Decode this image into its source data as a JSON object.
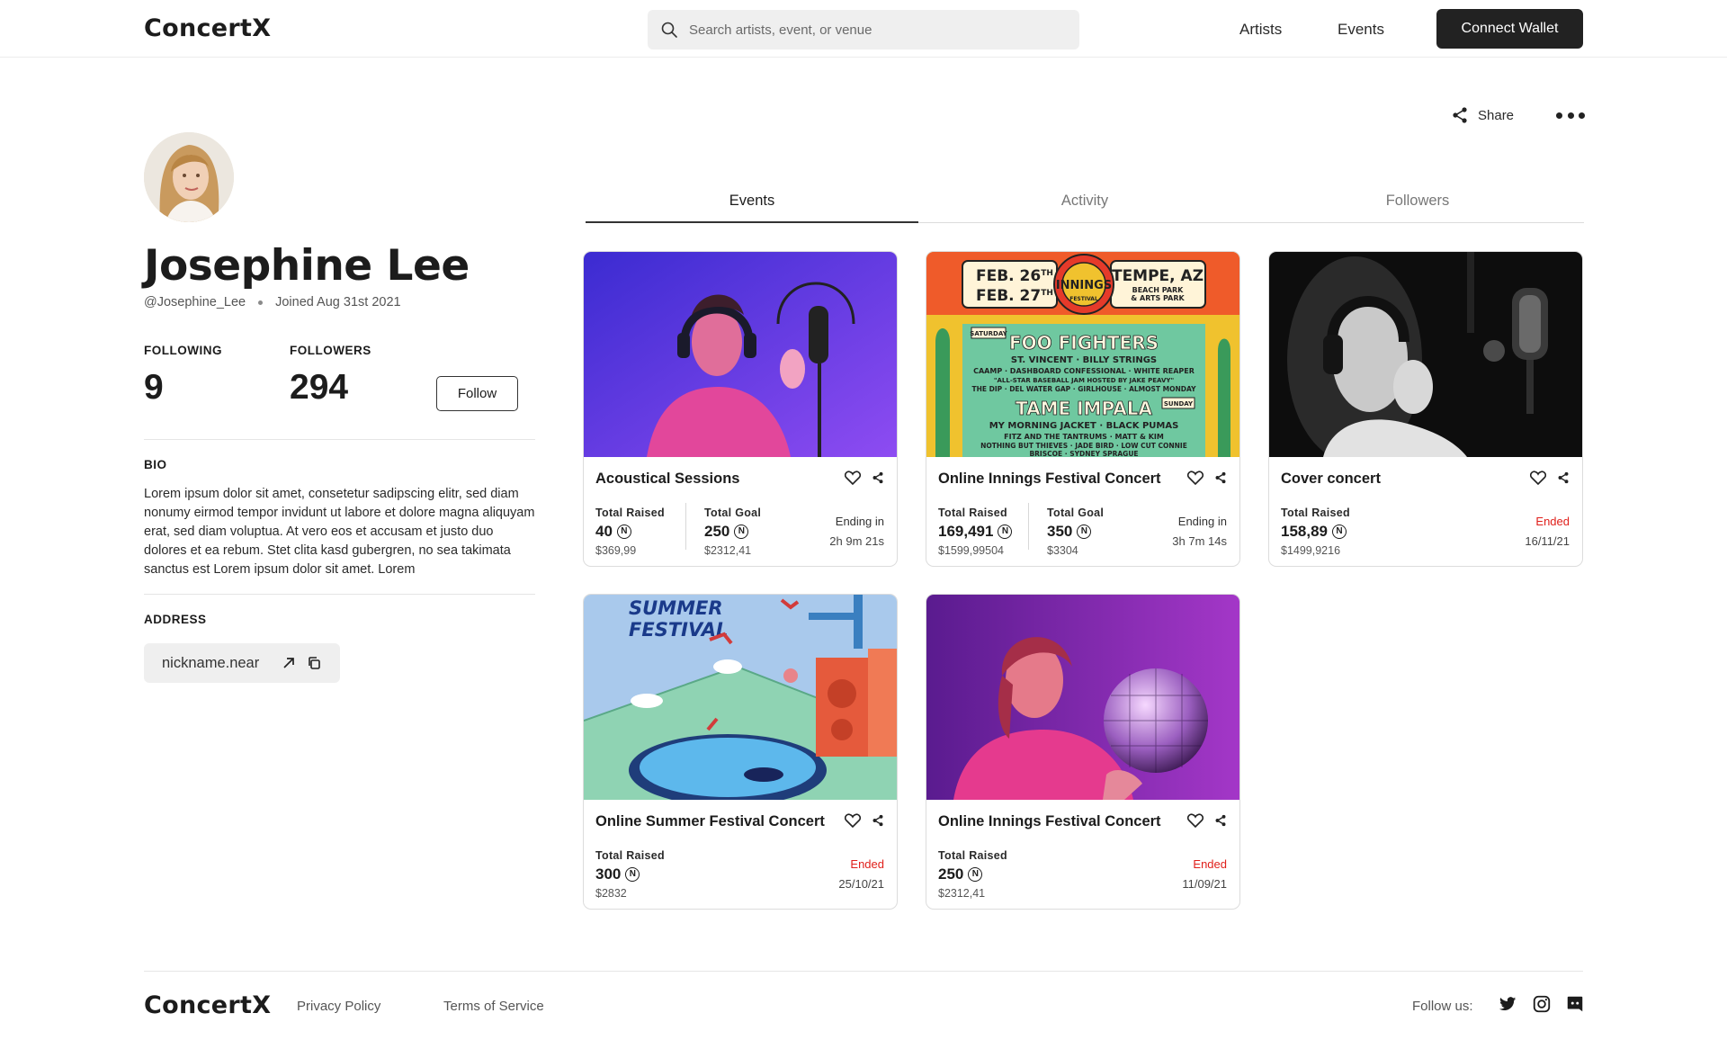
{
  "app": {
    "logo": "ConcertX"
  },
  "header": {
    "search_placeholder": "Search artists, event, or venue",
    "nav": [
      "Artists",
      "Events"
    ],
    "connect_wallet": "Connect Wallet"
  },
  "actions": {
    "share_label": "Share"
  },
  "profile": {
    "name": "Josephine Lee",
    "handle": "@Josephine_Lee",
    "joined": "Joined Aug 31st 2021",
    "following_label": "FOLLOWING",
    "following_count": "9",
    "followers_label": "FOLLOWERS",
    "followers_count": "294",
    "follow_button": "Follow",
    "bio_label": "BIO",
    "bio": "Lorem ipsum dolor sit amet, consetetur sadipscing elitr, sed diam nonumy eirmod tempor invidunt ut labore et dolore magna aliquyam erat, sed diam voluptua. At vero eos et accusam et justo duo dolores et ea rebum. Stet clita kasd gubergren, no sea takimata sanctus est Lorem ipsum dolor sit amet. Lorem",
    "address_label": "ADDRESS",
    "address": "nickname.near"
  },
  "tabs": [
    {
      "label": "Events",
      "active": true
    },
    {
      "label": "Activity",
      "active": false
    },
    {
      "label": "Followers",
      "active": false
    }
  ],
  "events": [
    {
      "title": "Acoustical Sessions",
      "raised_label": "Total Raised",
      "raised": "40",
      "raised_usd": "$369,99",
      "goal_label": "Total Goal",
      "goal": "250",
      "goal_usd": "$2312,41",
      "status": "Ending in",
      "time": "2h 9m 21s"
    },
    {
      "title": "Online Innings Festival Concert",
      "raised_label": "Total Raised",
      "raised": "169,491",
      "raised_usd": "$1599,99504",
      "goal_label": "Total Goal",
      "goal": "350",
      "goal_usd": "$3304",
      "status": "Ending in",
      "time": "3h 7m 14s"
    },
    {
      "title": "Cover concert",
      "raised_label": "Total Raised",
      "raised": "158,89",
      "raised_usd": "$1499,9216",
      "status": "Ended",
      "time": "16/11/21"
    },
    {
      "title": "Online Summer Festival Concert",
      "raised_label": "Total Raised",
      "raised": "300",
      "raised_usd": "$2832",
      "status": "Ended",
      "time": "25/10/21"
    },
    {
      "title": "Online Innings Festival Concert",
      "raised_label": "Total Raised",
      "raised": "250",
      "raised_usd": "$2312,41",
      "status": "Ended",
      "time": "11/09/21"
    }
  ],
  "poster": {
    "date1": "FEB. 26",
    "date2": "FEB. 27",
    "date_suffix": "TH",
    "city": "TEMPE, AZ",
    "venue1": "BEACH PARK",
    "venue2": "& ARTS PARK",
    "badge": "INNINGS",
    "badge_sub": "FESTIVAL",
    "day1": "SATURDAY",
    "headliner1": "FOO FIGHTERS",
    "sat_line1": "ST. VINCENT · BILLY STRINGS",
    "sat_line2": "CAAMP · DASHBOARD CONFESSIONAL · WHITE REAPER",
    "sat_line3": "\"ALL-STAR BASEBALL JAM HOSTED BY JAKE PEAVY\"",
    "sat_line4": "THE DIP · DEL WATER GAP · GIRLHOUSE · ALMOST MONDAY",
    "day2": "SUNDAY",
    "headliner2": "TAME IMPALA",
    "sun_line1": "MY MORNING JACKET · BLACK PUMAS",
    "sun_line2": "FITZ AND THE TANTRUMS · MATT & KIM",
    "sun_line3": "NOTHING BUT THIEVES · JADE BIRD · LOW CUT CONNIE",
    "sun_line4": "BRISCOE · SYDNEY SPRAGUE",
    "summer1": "SUMMER",
    "summer2": "FESTIVAL"
  },
  "near_symbol": "N",
  "footer": {
    "logo": "ConcertX",
    "privacy": "Privacy Policy",
    "terms": "Terms of Service",
    "follow_us": "Follow us:"
  },
  "icons": [
    "search-icon",
    "share-icon",
    "more-icon",
    "external-link-icon",
    "copy-icon",
    "heart-icon",
    "twitter-icon",
    "instagram-icon",
    "discord-icon"
  ]
}
